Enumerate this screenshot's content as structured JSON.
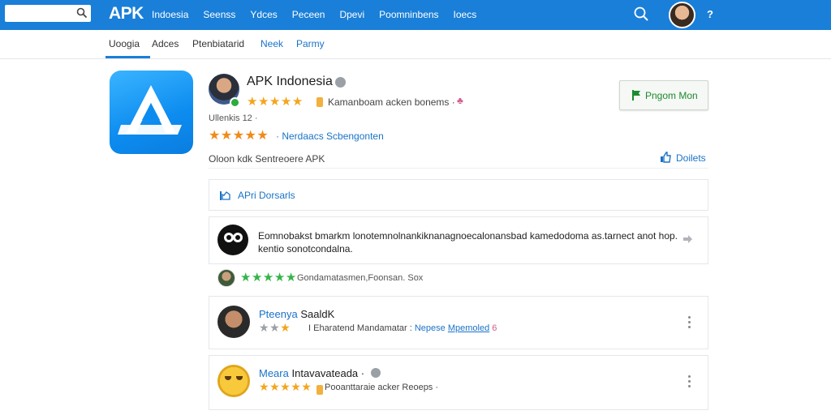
{
  "topbar": {
    "search": {
      "value": "",
      "placeholder": ""
    },
    "brand": "APK",
    "nav": [
      "Indoesia",
      "Seenss",
      "Ydces",
      "Peceen",
      "Dpevi",
      "Poomninbens",
      "Ioecs"
    ],
    "help_label": "?",
    "colors": {
      "bar": "#1a7fd8"
    }
  },
  "subtabs": {
    "items": [
      "Uoogia",
      "Adces",
      "Ptenbiatarid",
      "Neek",
      "Parmy"
    ],
    "active_index": 0
  },
  "app": {
    "title": "APK Indonesia",
    "rating_text": "Kamanboam acken bonems ·",
    "developer_line": "Ullenkis 12 ·",
    "secondary_rating_text": "· Nerdaacs  Scbengonten",
    "meta": "Oloon kdk  Sentreoere APK",
    "install_label": "Pngom Mon",
    "details_label": "Doilets"
  },
  "section": {
    "label": "APri Dorsarls"
  },
  "reviews": {
    "featured": {
      "text": "Eomnobakst bmarkm lonotemnolnankiknanagnoecalonansbad kamedodoma as.tarnect anot hop. kentio sonotcondalna."
    },
    "mini": {
      "text": "Gondamatasmen,Foonsan. Sox"
    },
    "items": [
      {
        "name": "Pteenya",
        "name_rest": "SaaldK",
        "text_plain": "I Eharatend Mandamatar :",
        "link1": "Nepese",
        "link2": "Mpemoled",
        "trail": "6"
      },
      {
        "name": "Meara",
        "name_rest": "Intavavateada ·",
        "text_plain": "Pooanttaraie acker Reoeps ·",
        "link1": "",
        "link2": "",
        "trail": ""
      }
    ]
  }
}
